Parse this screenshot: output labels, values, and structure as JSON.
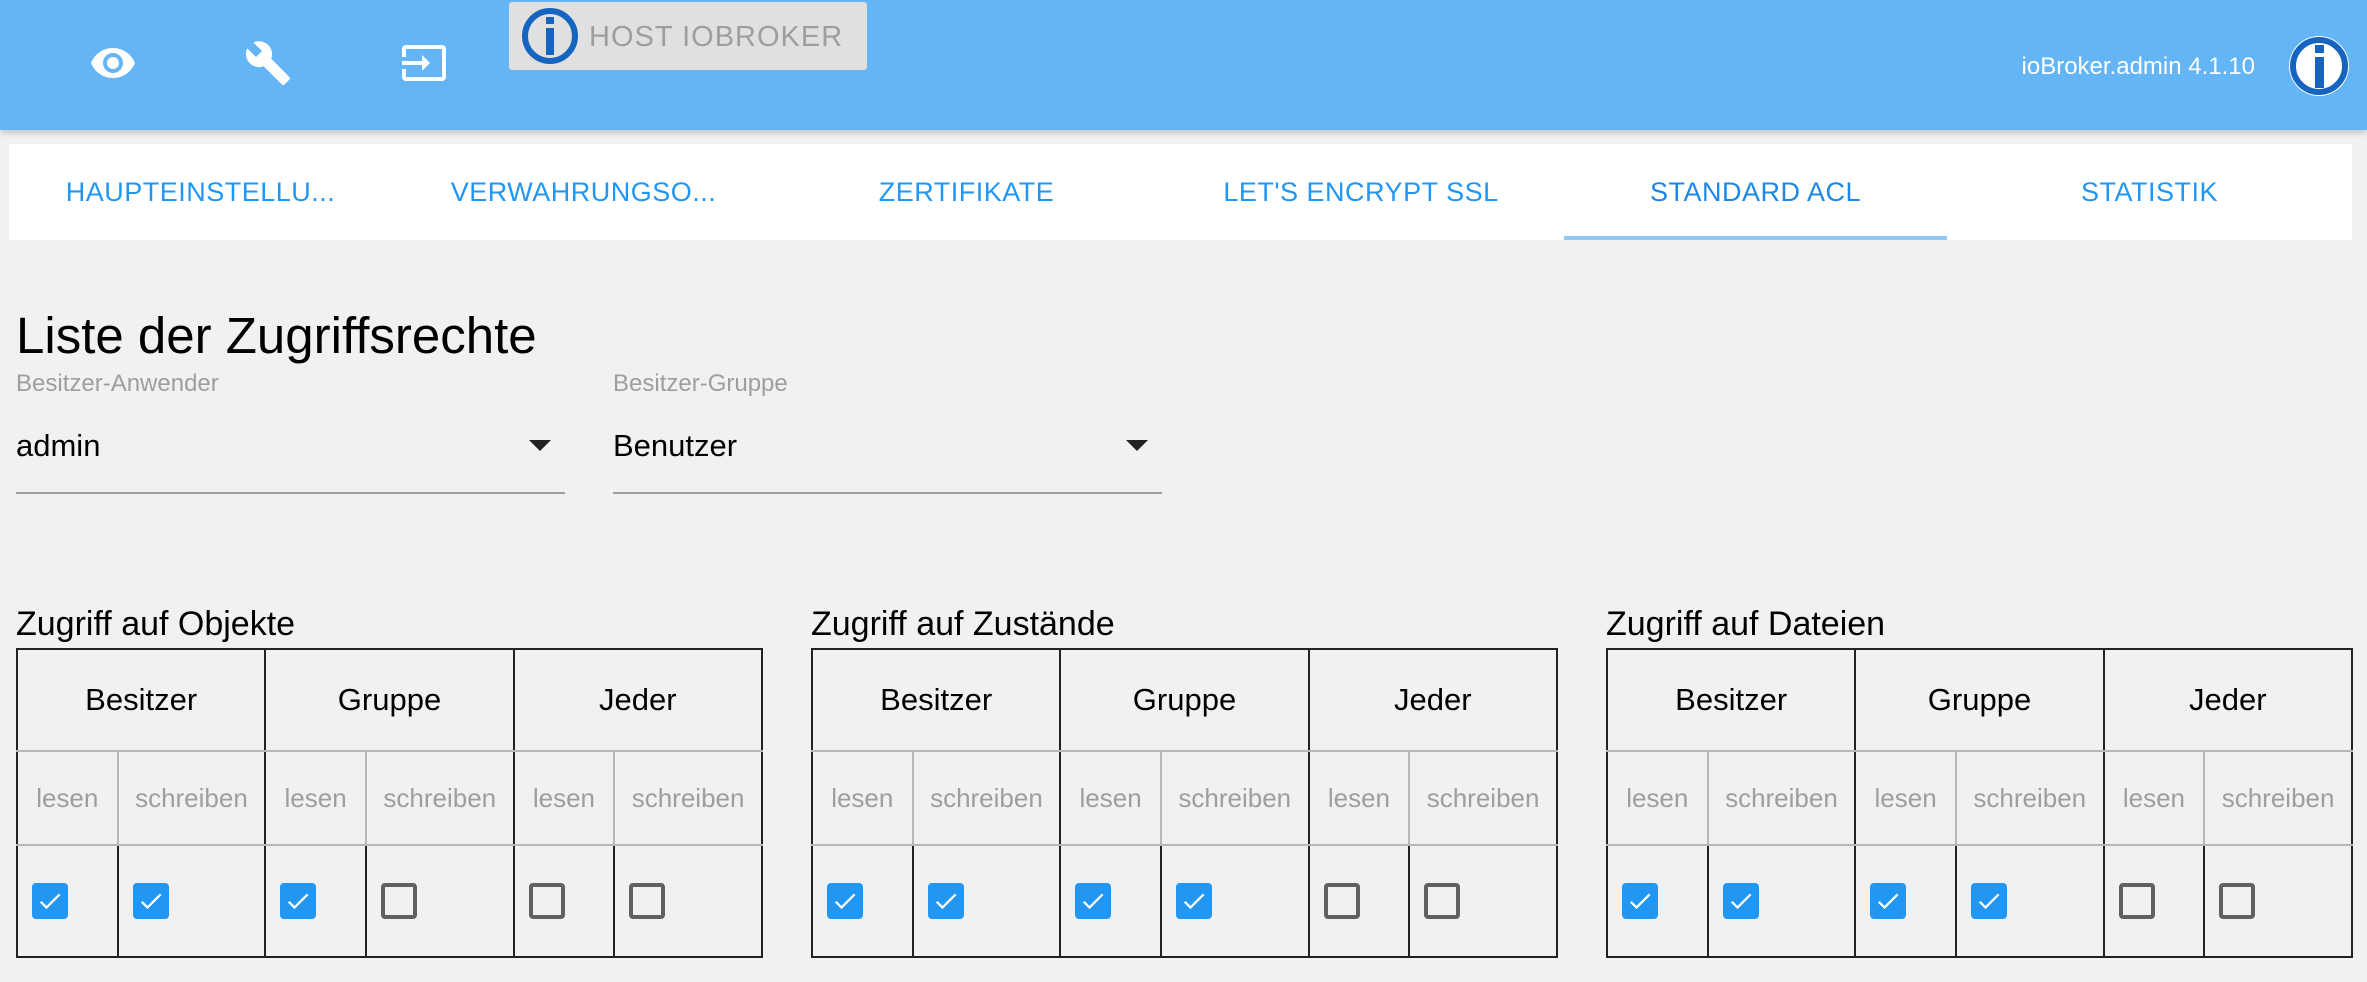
{
  "header": {
    "icons": [
      "eye-icon",
      "wrench-icon",
      "login-icon"
    ],
    "host_label": "HOST IOBROKER",
    "version": "ioBroker.admin 4.1.10",
    "brand_color": "#64b5f6"
  },
  "tabs": [
    {
      "label": "HAUPTEINSTELLU..."
    },
    {
      "label": "VERWAHRUNGSO..."
    },
    {
      "label": "ZERTIFIKATE"
    },
    {
      "label": "LET'S ENCRYPT SSL"
    },
    {
      "label": "STANDARD ACL",
      "active": true
    },
    {
      "label": "STATISTIK"
    }
  ],
  "main": {
    "title": "Liste der Zugriffsrechte",
    "owner_user": {
      "label": "Besitzer-Anwender",
      "value": "admin"
    },
    "owner_group": {
      "label": "Besitzer-Gruppe",
      "value": "Benutzer"
    },
    "columns": [
      "Besitzer",
      "Gruppe",
      "Jeder"
    ],
    "rights": [
      "lesen",
      "schreiben"
    ],
    "sections": [
      {
        "title": "Zugriff auf Objekte",
        "checks": [
          true,
          true,
          true,
          false,
          false,
          false
        ]
      },
      {
        "title": "Zugriff auf Zustände",
        "checks": [
          true,
          true,
          true,
          true,
          false,
          false
        ]
      },
      {
        "title": "Zugriff auf Dateien",
        "checks": [
          true,
          true,
          true,
          true,
          false,
          false
        ]
      }
    ]
  },
  "colors": {
    "accent": "#2196f3",
    "background": "#f3f1ef"
  }
}
